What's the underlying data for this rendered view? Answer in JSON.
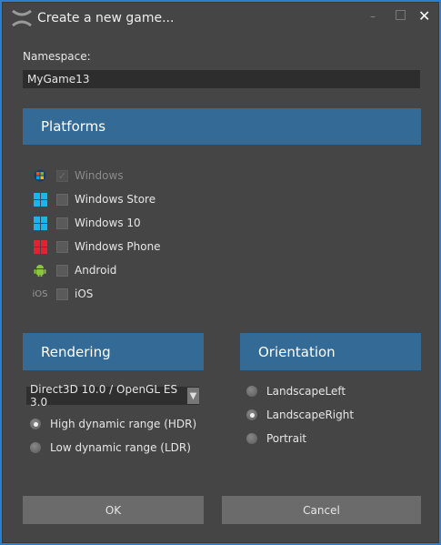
{
  "window": {
    "title": "Create a new game...",
    "minimize": "–",
    "maximize": "□",
    "close": "✕"
  },
  "namespace": {
    "label": "Namespace:",
    "value": "MyGame13"
  },
  "platforms": {
    "header": "Platforms",
    "items": [
      {
        "label": "Windows",
        "checked": true,
        "disabled": true,
        "icon": "windows-logo-icon"
      },
      {
        "label": "Windows Store",
        "checked": false,
        "icon": "windows-tile-icon",
        "color": "#1ab4ef"
      },
      {
        "label": "Windows 10",
        "checked": false,
        "icon": "windows-tile-icon",
        "color": "#1ab4ef"
      },
      {
        "label": "Windows Phone",
        "checked": false,
        "icon": "windows-tile-icon",
        "color": "#e8202f"
      },
      {
        "label": "Android",
        "checked": false,
        "icon": "android-icon",
        "color": "#8cc63f"
      },
      {
        "label": "iOS",
        "checked": false,
        "icon": "ios-text-icon",
        "icon_text": "iOS"
      }
    ]
  },
  "rendering": {
    "header": "Rendering",
    "select_value": "Direct3D 10.0 / OpenGL ES 3.0",
    "options": [
      {
        "label": "High dynamic range (HDR)",
        "selected": true
      },
      {
        "label": "Low dynamic range (LDR)",
        "selected": false
      }
    ]
  },
  "orientation": {
    "header": "Orientation",
    "options": [
      {
        "label": "LandscapeLeft",
        "selected": false
      },
      {
        "label": "LandscapeRight",
        "selected": true
      },
      {
        "label": "Portrait",
        "selected": false
      }
    ]
  },
  "buttons": {
    "ok": "OK",
    "cancel": "Cancel"
  }
}
